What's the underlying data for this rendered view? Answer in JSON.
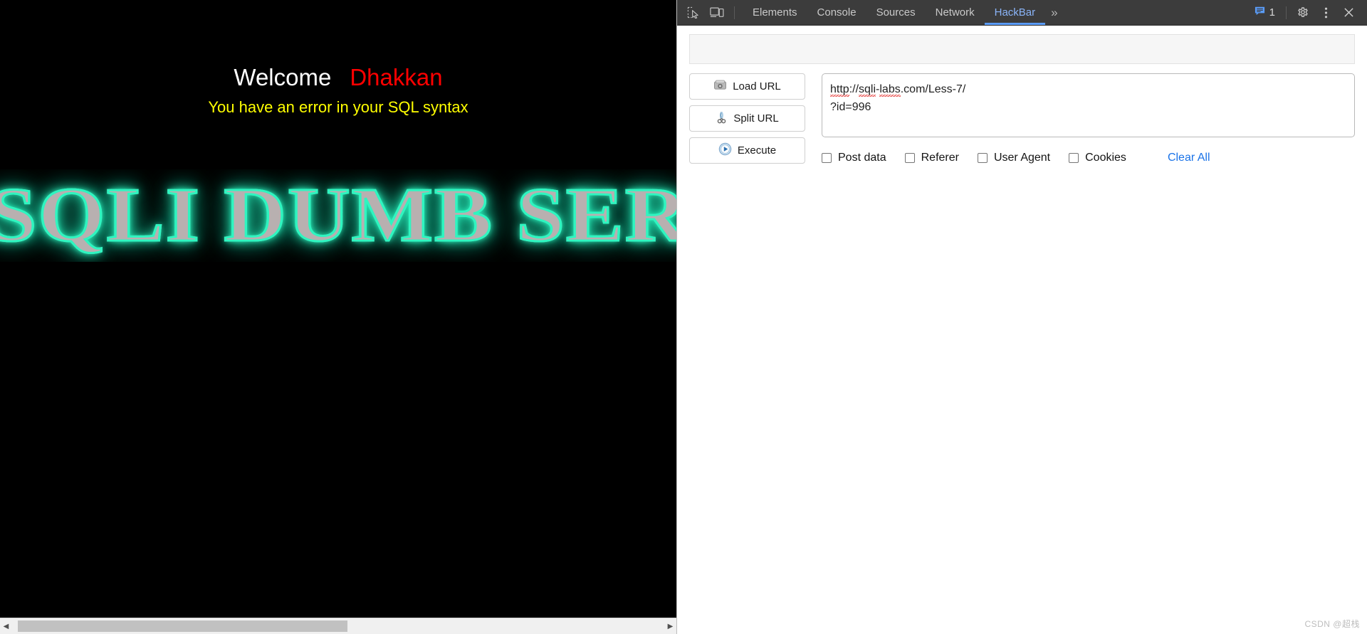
{
  "page": {
    "welcome_word": "Welcome",
    "welcome_name": "Dhakkan",
    "error_text": "You have an error in your SQL syntax",
    "banner_text": "SQLI DUMB SERIES",
    "background_color": "#000000",
    "welcome_color": "#ffffff",
    "name_color": "#ff0000",
    "error_color": "#ffff00",
    "banner_glow_color": "#2ff5c0"
  },
  "devtools": {
    "inspect_icon": "inspect-element-icon",
    "device_icon": "device-toolbar-icon",
    "tabs": [
      {
        "label": "Elements",
        "active": false
      },
      {
        "label": "Console",
        "active": false
      },
      {
        "label": "Sources",
        "active": false
      },
      {
        "label": "Network",
        "active": false
      },
      {
        "label": "HackBar",
        "active": true
      }
    ],
    "more_tabs": "»",
    "message_count": "1",
    "message_icon": "console-message-icon",
    "settings_icon": "gear-icon",
    "menu_icon": "kebab-menu-icon",
    "close_icon": "close-icon",
    "active_tab_color": "#8ab4f8",
    "toolbar_bg": "#3c3c3c"
  },
  "hackbar": {
    "buttons": [
      {
        "label": "Load URL",
        "icon": "load-url-icon"
      },
      {
        "label": "Split URL",
        "icon": "scissors-icon"
      },
      {
        "label": "Execute",
        "icon": "play-icon"
      }
    ],
    "url_value": "http://sqli-labs.com/Less-7/?id=996",
    "url_line_1_a": "http",
    "url_line_1_b": "://",
    "url_line_1_c": "sqli",
    "url_line_1_d": "-",
    "url_line_1_e": "labs",
    "url_line_1_f": ".com/Less-7/",
    "url_line_2": "?id=996",
    "url_placeholder": "",
    "options": [
      {
        "label": "Post data",
        "checked": false
      },
      {
        "label": "Referer",
        "checked": false
      },
      {
        "label": "User Agent",
        "checked": false
      },
      {
        "label": "Cookies",
        "checked": false
      }
    ],
    "clear_all_label": "Clear All",
    "clear_all_color": "#1a73e8"
  },
  "scrollbar": {
    "left_arrow": "◀",
    "right_arrow": "▶"
  },
  "watermark": {
    "text": "CSDN @超栈"
  }
}
